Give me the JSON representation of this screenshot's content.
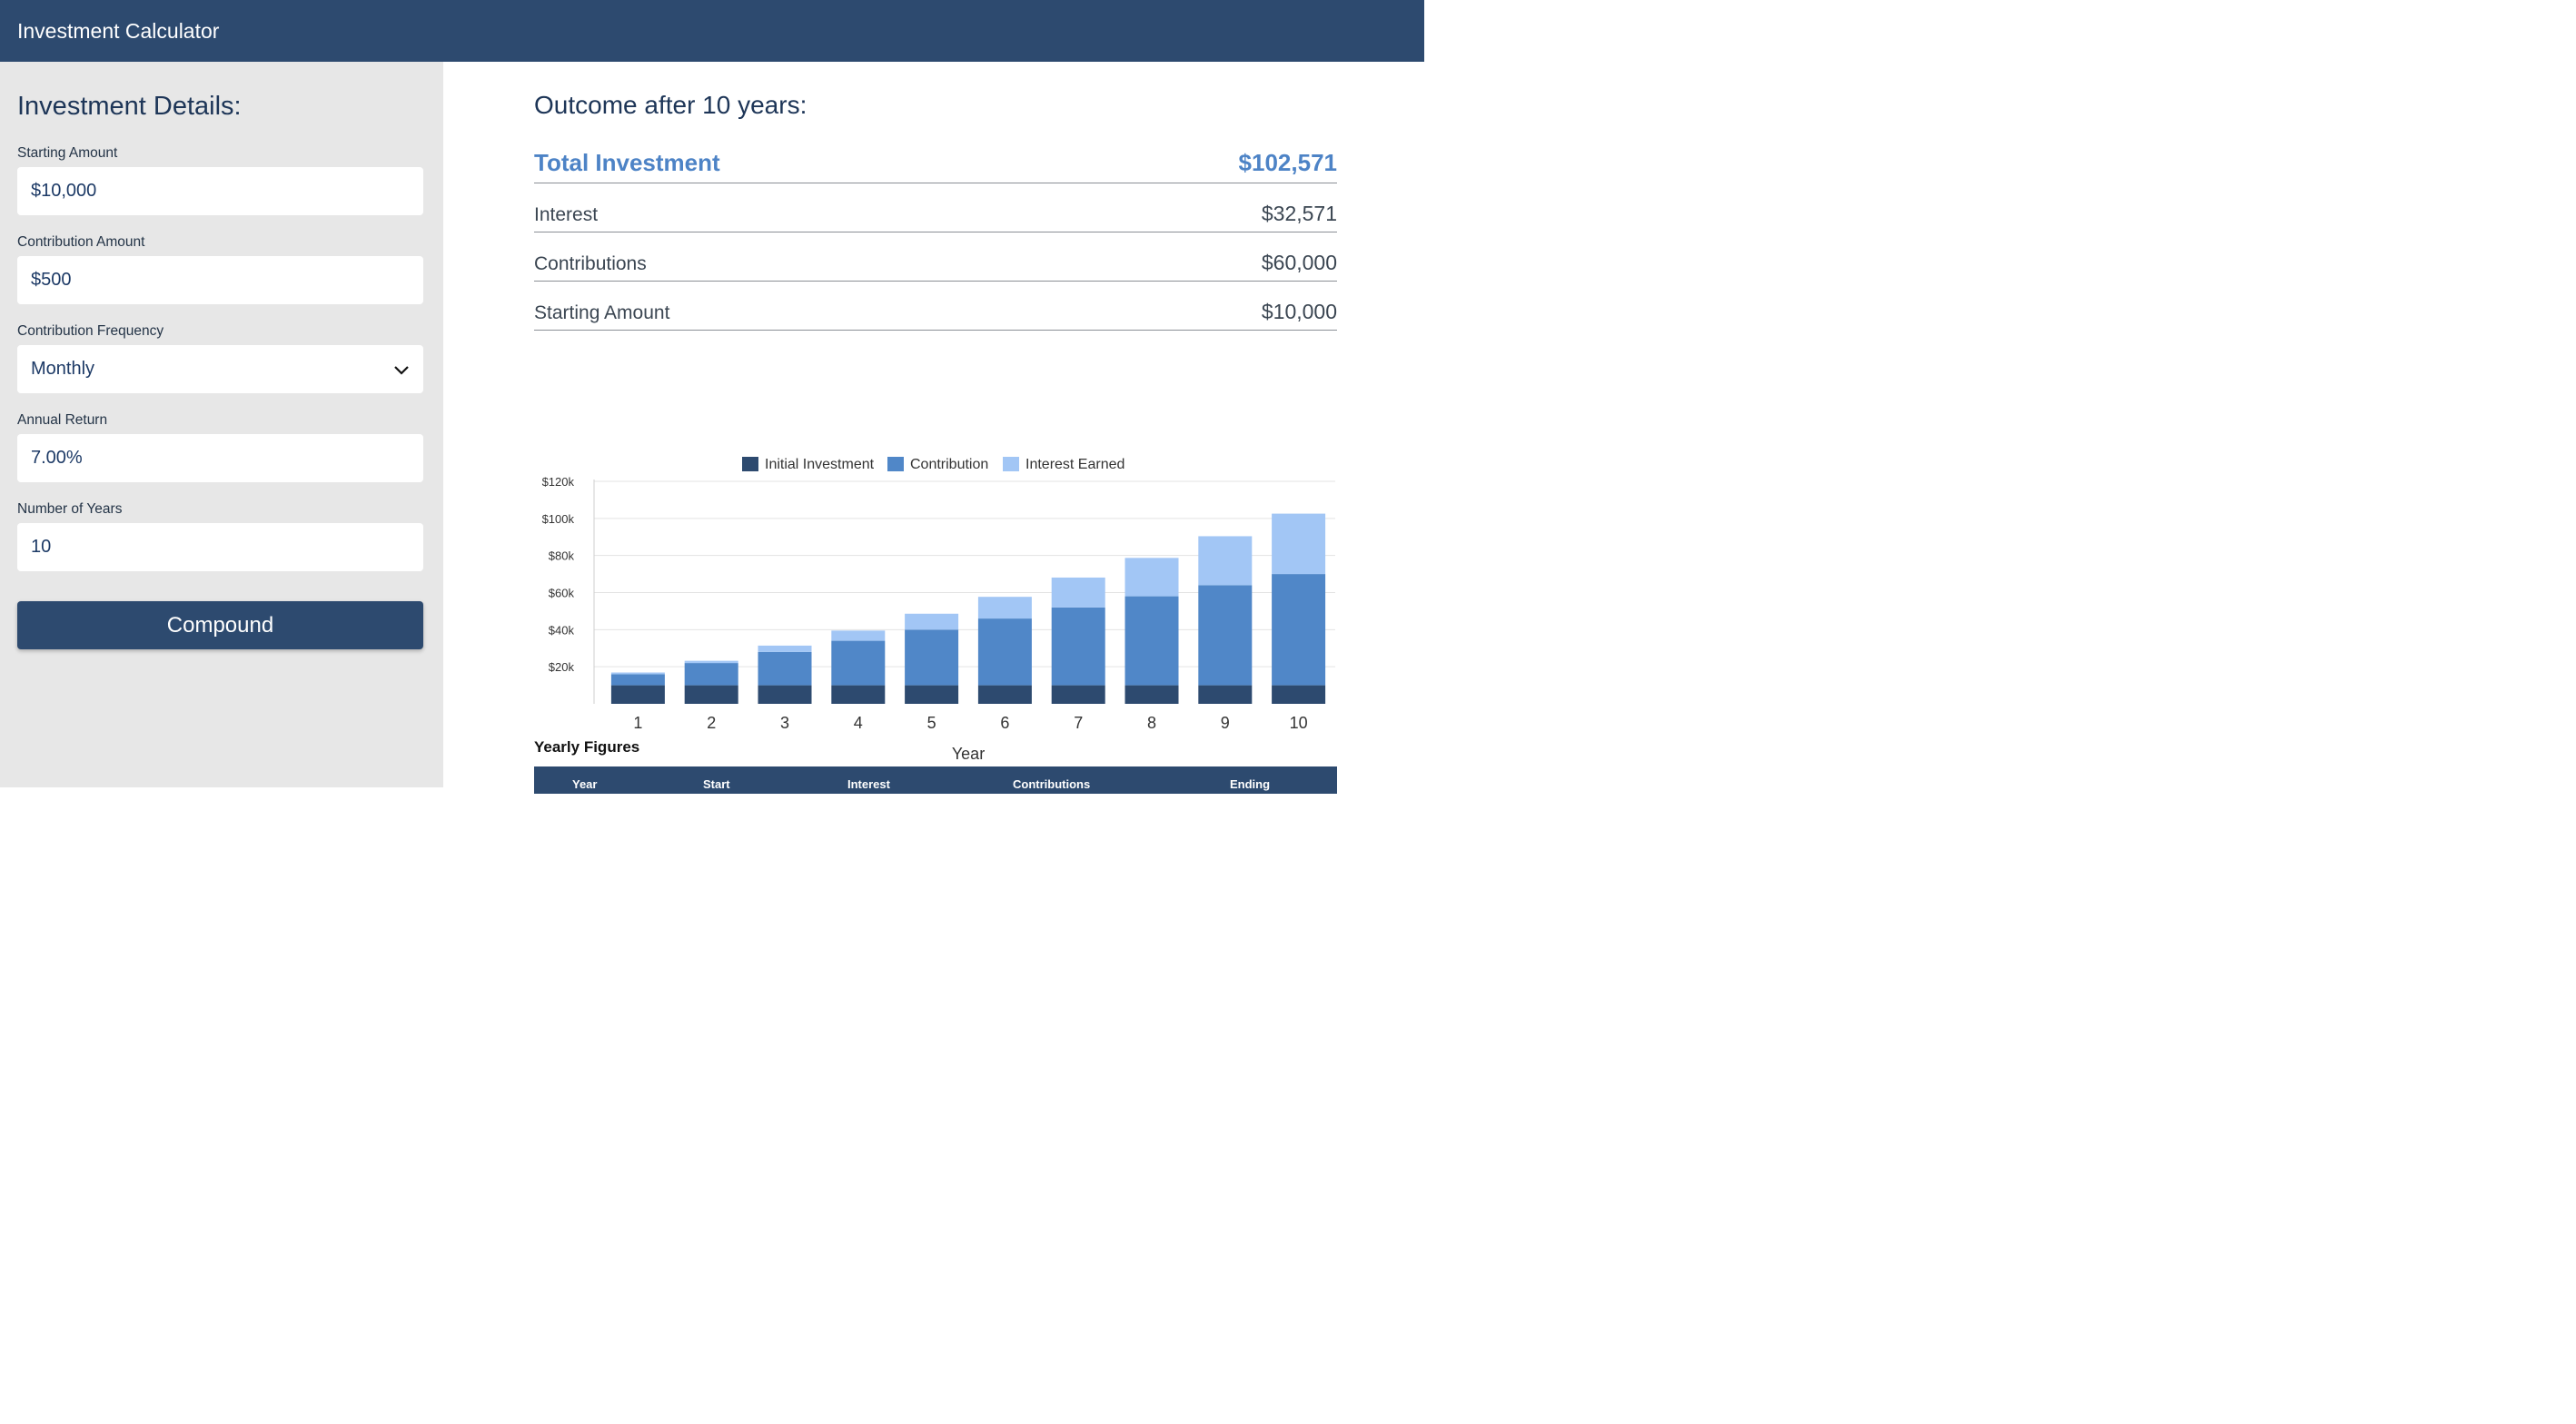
{
  "app": {
    "title": "Investment Calculator"
  },
  "form": {
    "heading": "Investment Details:",
    "starting_amount": {
      "label": "Starting Amount",
      "value": "$10,000"
    },
    "contribution_amount": {
      "label": "Contribution Amount",
      "value": "$500"
    },
    "contribution_frequency": {
      "label": "Contribution Frequency",
      "value": "Monthly"
    },
    "annual_return": {
      "label": "Annual Return",
      "value": "7.00%"
    },
    "years": {
      "label": "Number of Years",
      "value": "10"
    },
    "submit_label": "Compound"
  },
  "outcome": {
    "heading": "Outcome after 10 years:",
    "total_label": "Total Investment",
    "total_value": "$102,571",
    "interest_label": "Interest",
    "interest_value": "$32,571",
    "contributions_label": "Contributions",
    "contributions_value": "$60,000",
    "starting_label": "Starting Amount",
    "starting_value": "$10,000"
  },
  "chart_data": {
    "type": "bar",
    "stacked": true,
    "xlabel": "Year",
    "categories": [
      "1",
      "2",
      "3",
      "4",
      "5",
      "6",
      "7",
      "8",
      "9",
      "10"
    ],
    "ylim": [
      0,
      120000
    ],
    "yticks": [
      20000,
      40000,
      60000,
      80000,
      100000,
      120000
    ],
    "ytick_labels": [
      "$20k",
      "$40k",
      "$60k",
      "$80k",
      "$100k",
      "$120k"
    ],
    "grid": true,
    "legend_position": "top",
    "series": [
      {
        "name": "Initial Investment",
        "color": "#2d4a6f",
        "values": [
          10000,
          10000,
          10000,
          10000,
          10000,
          10000,
          10000,
          10000,
          10000,
          10000
        ]
      },
      {
        "name": "Contribution",
        "color": "#5087c8",
        "values": [
          6000,
          12000,
          18000,
          24000,
          30000,
          36000,
          42000,
          48000,
          54000,
          60000
        ]
      },
      {
        "name": "Interest Earned",
        "color": "#a2c6f5",
        "values": [
          900,
          1200,
          3400,
          5500,
          8600,
          11700,
          16100,
          20700,
          26400,
          32571
        ]
      }
    ]
  },
  "table": {
    "title": "Yearly Figures",
    "headers": [
      "Year",
      "Start",
      "Interest",
      "Contributions",
      "Ending"
    ]
  }
}
